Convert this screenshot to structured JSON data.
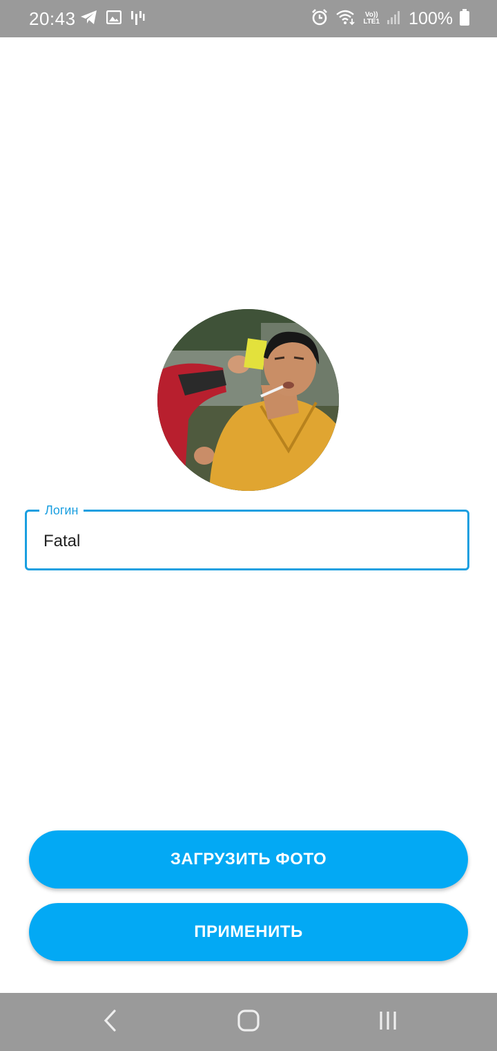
{
  "status_bar": {
    "time": "20:43",
    "left_icons": [
      "telegram-icon",
      "image-icon",
      "audio-bars-icon"
    ],
    "right_icons": [
      "alarm-icon",
      "wifi-icon",
      "volte-lte-icon",
      "signal-icon",
      "battery-icon"
    ],
    "lte_top": "Vo))",
    "lte_bottom": "LTE1",
    "battery_percent": "100%"
  },
  "profile": {
    "avatar_description_icon": "avatar-photo"
  },
  "login_field": {
    "label": "Логин",
    "value": "Fatal"
  },
  "buttons": {
    "upload_label": "ЗАГРУЗИТЬ ФОТО",
    "apply_label": "ПРИМЕНИТЬ"
  },
  "nav_bar": {
    "icons": [
      "back-icon",
      "home-icon",
      "recents-icon"
    ]
  },
  "colors": {
    "accent": "#03a9f4",
    "field_border": "#1a9fe0",
    "system_bar": "#9a9a9a"
  }
}
